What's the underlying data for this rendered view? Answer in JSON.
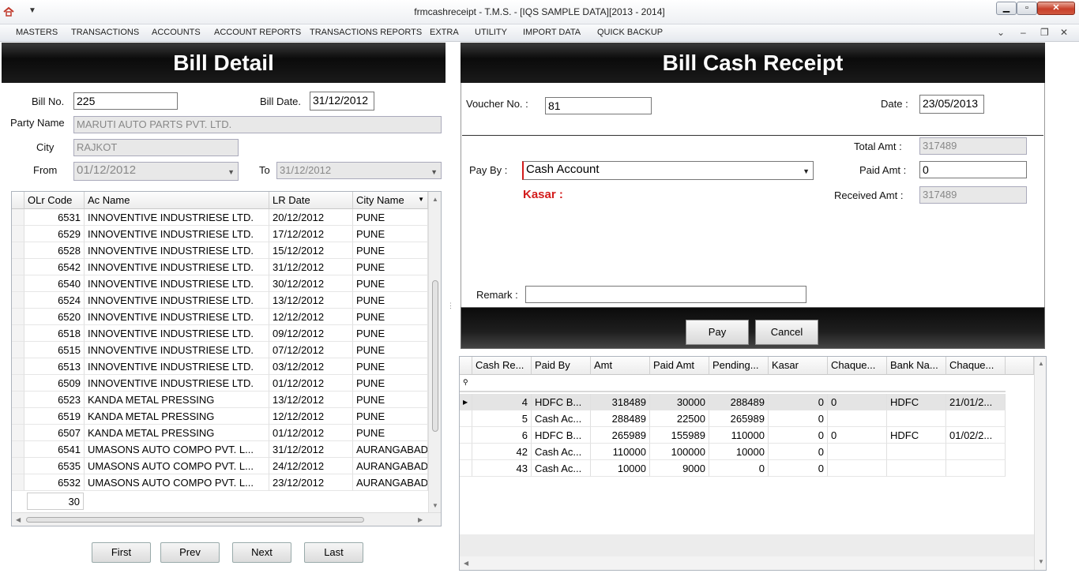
{
  "window": {
    "title": "frmcashreceipt - T.M.S. - [IQS SAMPLE DATA][2013 - 2014]",
    "minimize_glyph": "▁",
    "maximize_glyph": "▫",
    "close_glyph": "✕"
  },
  "menu": [
    "MASTERS",
    "TRANSACTIONS",
    "ACCOUNTS",
    "ACCOUNT REPORTS",
    "TRANSACTIONS REPORTS",
    "EXTRA",
    "UTILITY",
    "IMPORT DATA",
    "QUICK BACKUP"
  ],
  "bill_detail": {
    "header": "Bill Detail",
    "bill_no_label": "Bill No.",
    "bill_no": "225",
    "bill_date_label": "Bill Date.",
    "bill_date": "31/12/2012",
    "party_label": "Party Name",
    "party": "MARUTI AUTO PARTS PVT. LTD.",
    "city_label": "City",
    "city": "RAJKOT",
    "from_label": "From",
    "from": "01/12/2012",
    "to_label": "To",
    "to": "31/12/2012",
    "grid": {
      "columns": [
        "OLr Code",
        "Ac Name",
        "LR Date",
        "City Name"
      ],
      "rows": [
        [
          "6531",
          "INNOVENTIVE INDUSTRIESE LTD.",
          "20/12/2012",
          "PUNE"
        ],
        [
          "6529",
          "INNOVENTIVE INDUSTRIESE LTD.",
          "17/12/2012",
          "PUNE"
        ],
        [
          "6528",
          "INNOVENTIVE INDUSTRIESE LTD.",
          "15/12/2012",
          "PUNE"
        ],
        [
          "6542",
          "INNOVENTIVE INDUSTRIESE LTD.",
          "31/12/2012",
          "PUNE"
        ],
        [
          "6540",
          "INNOVENTIVE INDUSTRIESE LTD.",
          "30/12/2012",
          "PUNE"
        ],
        [
          "6524",
          "INNOVENTIVE INDUSTRIESE LTD.",
          "13/12/2012",
          "PUNE"
        ],
        [
          "6520",
          "INNOVENTIVE INDUSTRIESE LTD.",
          "12/12/2012",
          "PUNE"
        ],
        [
          "6518",
          "INNOVENTIVE INDUSTRIESE LTD.",
          "09/12/2012",
          "PUNE"
        ],
        [
          "6515",
          "INNOVENTIVE INDUSTRIESE LTD.",
          "07/12/2012",
          "PUNE"
        ],
        [
          "6513",
          "INNOVENTIVE INDUSTRIESE LTD.",
          "03/12/2012",
          "PUNE"
        ],
        [
          "6509",
          "INNOVENTIVE INDUSTRIESE LTD.",
          "01/12/2012",
          "PUNE"
        ],
        [
          "6523",
          "KANDA METAL PRESSING",
          "13/12/2012",
          "PUNE"
        ],
        [
          "6519",
          "KANDA METAL PRESSING",
          "12/12/2012",
          "PUNE"
        ],
        [
          "6507",
          "KANDA METAL PRESSING",
          "01/12/2012",
          "PUNE"
        ],
        [
          "6541",
          "UMASONS AUTO COMPO PVT. L...",
          "31/12/2012",
          "AURANGABAD"
        ],
        [
          "6535",
          "UMASONS AUTO COMPO PVT. L...",
          "24/12/2012",
          "AURANGABAD"
        ],
        [
          "6532",
          "UMASONS AUTO COMPO PVT. L...",
          "23/12/2012",
          "AURANGABAD"
        ]
      ],
      "row_count": "30"
    },
    "nav": {
      "first": "First",
      "prev": "Prev",
      "next": "Next",
      "last": "Last"
    }
  },
  "cash_receipt": {
    "header": "Bill Cash Receipt",
    "voucher_label": "Voucher No. :",
    "voucher_no": "81",
    "date_label": "Date :",
    "date": "23/05/2013",
    "total_label": "Total Amt :",
    "total_amt": "317489",
    "pay_by_label": "Pay By :",
    "pay_by": "Cash Account",
    "paid_label": "Paid Amt :",
    "paid_amt": "0",
    "received_label": "Received Amt :",
    "received_amt": "317489",
    "kasar_label": "Kasar :",
    "remark_label": "Remark :",
    "remark": "",
    "pay_button": "Pay",
    "cancel_button": "Cancel",
    "grid": {
      "columns": [
        "Cash Re...",
        "Paid By",
        "Amt",
        "Paid Amt",
        "Pending...",
        "Kasar",
        "Chaque...",
        "Bank Na...",
        "Chaque..."
      ],
      "rows": [
        [
          "4",
          "HDFC B...",
          "318489",
          "30000",
          "288489",
          "0",
          "0",
          "HDFC",
          "21/01/2..."
        ],
        [
          "5",
          "Cash Ac...",
          "288489",
          "22500",
          "265989",
          "0",
          "",
          "",
          ""
        ],
        [
          "6",
          "HDFC B...",
          "265989",
          "155989",
          "110000",
          "0",
          "0",
          "HDFC",
          "01/02/2..."
        ],
        [
          "42",
          "Cash Ac...",
          "110000",
          "100000",
          "10000",
          "0",
          "",
          "",
          ""
        ],
        [
          "43",
          "Cash Ac...",
          "10000",
          "9000",
          "0",
          "0",
          "",
          "",
          ""
        ]
      ]
    }
  },
  "colors": {
    "kasar": "#d31c1c",
    "header_bg": "#111111"
  }
}
